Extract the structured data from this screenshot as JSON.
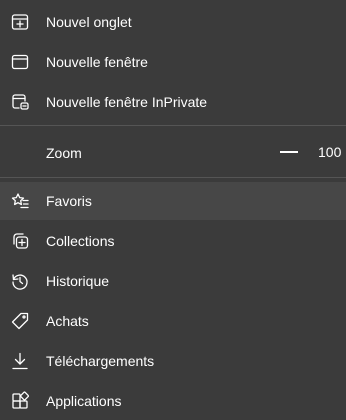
{
  "menu": {
    "new_tab": "Nouvel onglet",
    "new_window": "Nouvelle fenêtre",
    "new_inprivate": "Nouvelle fenêtre InPrivate",
    "zoom_label": "Zoom",
    "zoom_value": "100",
    "favorites": "Favoris",
    "collections": "Collections",
    "history": "Historique",
    "shopping": "Achats",
    "downloads": "Téléchargements",
    "apps": "Applications"
  },
  "icons": {
    "new_tab": "new-tab-icon",
    "new_window": "window-icon",
    "new_inprivate": "inprivate-icon",
    "favorites": "star-list-icon",
    "collections": "collections-icon",
    "history": "history-icon",
    "shopping": "tag-icon",
    "downloads": "download-icon",
    "apps": "apps-icon"
  },
  "colors": {
    "background": "#3b3b3b",
    "hover": "#474747",
    "divider": "#555555",
    "text": "#ffffff"
  }
}
